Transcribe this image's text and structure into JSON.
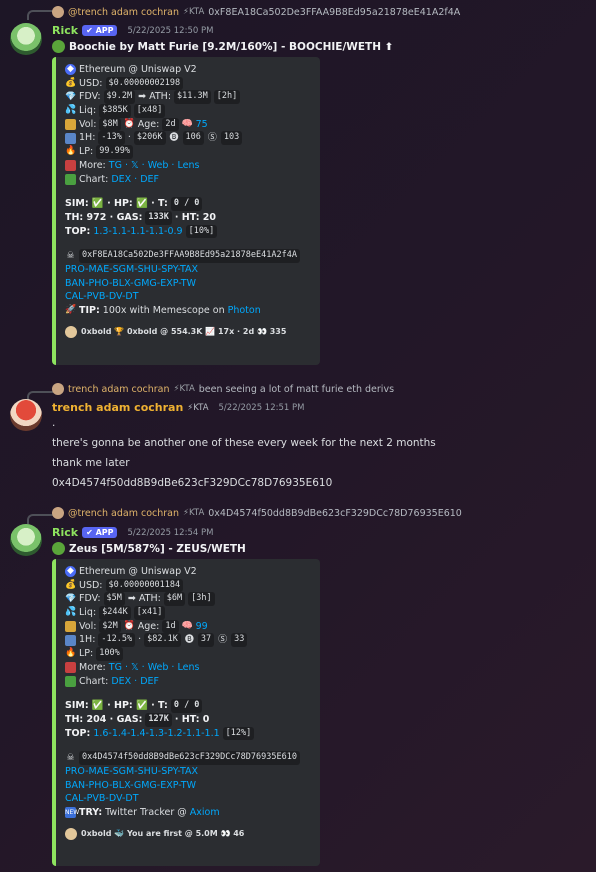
{
  "messages": [
    {
      "reply": {
        "name": "@trench adam cochran",
        "tag": "⚡KTA",
        "text": "0xF8EA18Ca502De3FFAA9B8Ed95a21878eE41A2f4A"
      },
      "author": "Rick",
      "badge": "✔ APP",
      "timestamp": "5/22/2025 12:50 PM",
      "title": "Boochie by Matt Furie [9.2M/160%] - BOOCHIE/WETH ⬆",
      "embed": {
        "chain": "Ethereum @ Uniswap V2",
        "usd_label": "USD:",
        "usd": "$0.00000002198",
        "fdv_label": "FDV:",
        "fdv": "$9.2M",
        "ath_label": "➡ ATH:",
        "ath": "$11.3M",
        "ath_age": "[2h]",
        "liq_label": "Liq:",
        "liq": "$385K",
        "liq_mult": "[x48]",
        "vol_label": "Vol:",
        "vol": "$8M",
        "age_label": "Age:",
        "age": "2d",
        "brain": "75",
        "h1_label": "1H:",
        "h1": "-13%",
        "h1_sep": "·",
        "h1_vol": "$206K",
        "buys": "106",
        "sells": "103",
        "lp_label": "LP:",
        "lp": "99.99%",
        "more_label": "More:",
        "more_links": "TG · 𝕏 · Web · Lens",
        "chart_label": "Chart:",
        "chart_links": "DEX · DEF",
        "sim_line": "SIM: ✅ · HP: ✅ · T:",
        "tax": "0 / 0",
        "th_line": "TH: 972 · GAS:",
        "gas": "133K",
        "ht": "· HT: 20",
        "top_label": "TOP:",
        "top": "1.3-1.1-1.1-1.1-0.9",
        "top_pct": "[10%]",
        "contract": "0xF8EA18Ca502De3FFAA9B8Ed95a21878eE41A2f4A",
        "links1": "PRO-MAE-SGM-SHU-SPY-TAX",
        "links2": "BAN-PHO-BLX-GMG-EXP-TW",
        "links3": "CAL-PVB-DV-DT",
        "tip_label": "TIP:",
        "tip": "100x with Memescope on",
        "tip_link": "Photon",
        "footer": "0xbold 🏆 0xbold @ 554.3K 📈 17x · 2d 👀 335"
      }
    },
    {
      "reply": {
        "name": "trench adam cochran",
        "tag": "⚡KTA",
        "text": "been seeing a lot of matt furie eth derivs"
      },
      "author": "trench adam cochran",
      "badge": "⚡KTA",
      "timestamp": "5/22/2025 12:51 PM",
      "lines": [
        ".",
        "there's gonna be another one of these every week for the next 2 months",
        "thank me later",
        "0x4D4574f50dd8B9dBe623cF329DCc78D76935E610"
      ]
    },
    {
      "reply": {
        "name": "@trench adam cochran",
        "tag": "⚡KTA",
        "text": "0x4D4574f50dd8B9dBe623cF329DCc78D76935E610"
      },
      "author": "Rick",
      "badge": "✔ APP",
      "timestamp": "5/22/2025 12:54 PM",
      "title": "Zeus [5M/587%] - ZEUS/WETH",
      "embed": {
        "chain": "Ethereum @ Uniswap V2",
        "usd_label": "USD:",
        "usd": "$0.00000001184",
        "fdv_label": "FDV:",
        "fdv": "$5M",
        "ath_label": "➡ ATH:",
        "ath": "$6M",
        "ath_age": "[3h]",
        "liq_label": "Liq:",
        "liq": "$244K",
        "liq_mult": "[x41]",
        "vol_label": "Vol:",
        "vol": "$2M",
        "age_label": "Age:",
        "age": "1d",
        "brain": "99",
        "h1_label": "1H:",
        "h1": "-12.5%",
        "h1_sep": "·",
        "h1_vol": "$82.1K",
        "buys": "37",
        "sells": "33",
        "lp_label": "LP:",
        "lp": "100%",
        "more_label": "More:",
        "more_links": "TG · 𝕏 · Web · Lens",
        "chart_label": "Chart:",
        "chart_links": "DEX · DEF",
        "sim_line": "SIM: ✅ · HP: ✅ · T:",
        "tax": "0 / 0",
        "th_line": "TH: 204 · GAS:",
        "gas": "127K",
        "ht": "· HT: 0",
        "top_label": "TOP:",
        "top": "1.6-1.4-1.4-1.3-1.2-1.1-1.1",
        "top_pct": "[12%]",
        "contract": "0x4D4574f50dd8B9dBe623cF329DCc78D76935E610",
        "links1": "PRO-MAE-SGM-SHU-SPY-TAX",
        "links2": "BAN-PHO-BLX-GMG-EXP-TW",
        "links3": "CAL-PVB-DV-DT",
        "tip_label": "TRY:",
        "tip": "Twitter Tracker @",
        "tip_link": "Axiom",
        "footer": "0xbold 🐳 You are first @ 5.0M 👀 46"
      }
    }
  ]
}
